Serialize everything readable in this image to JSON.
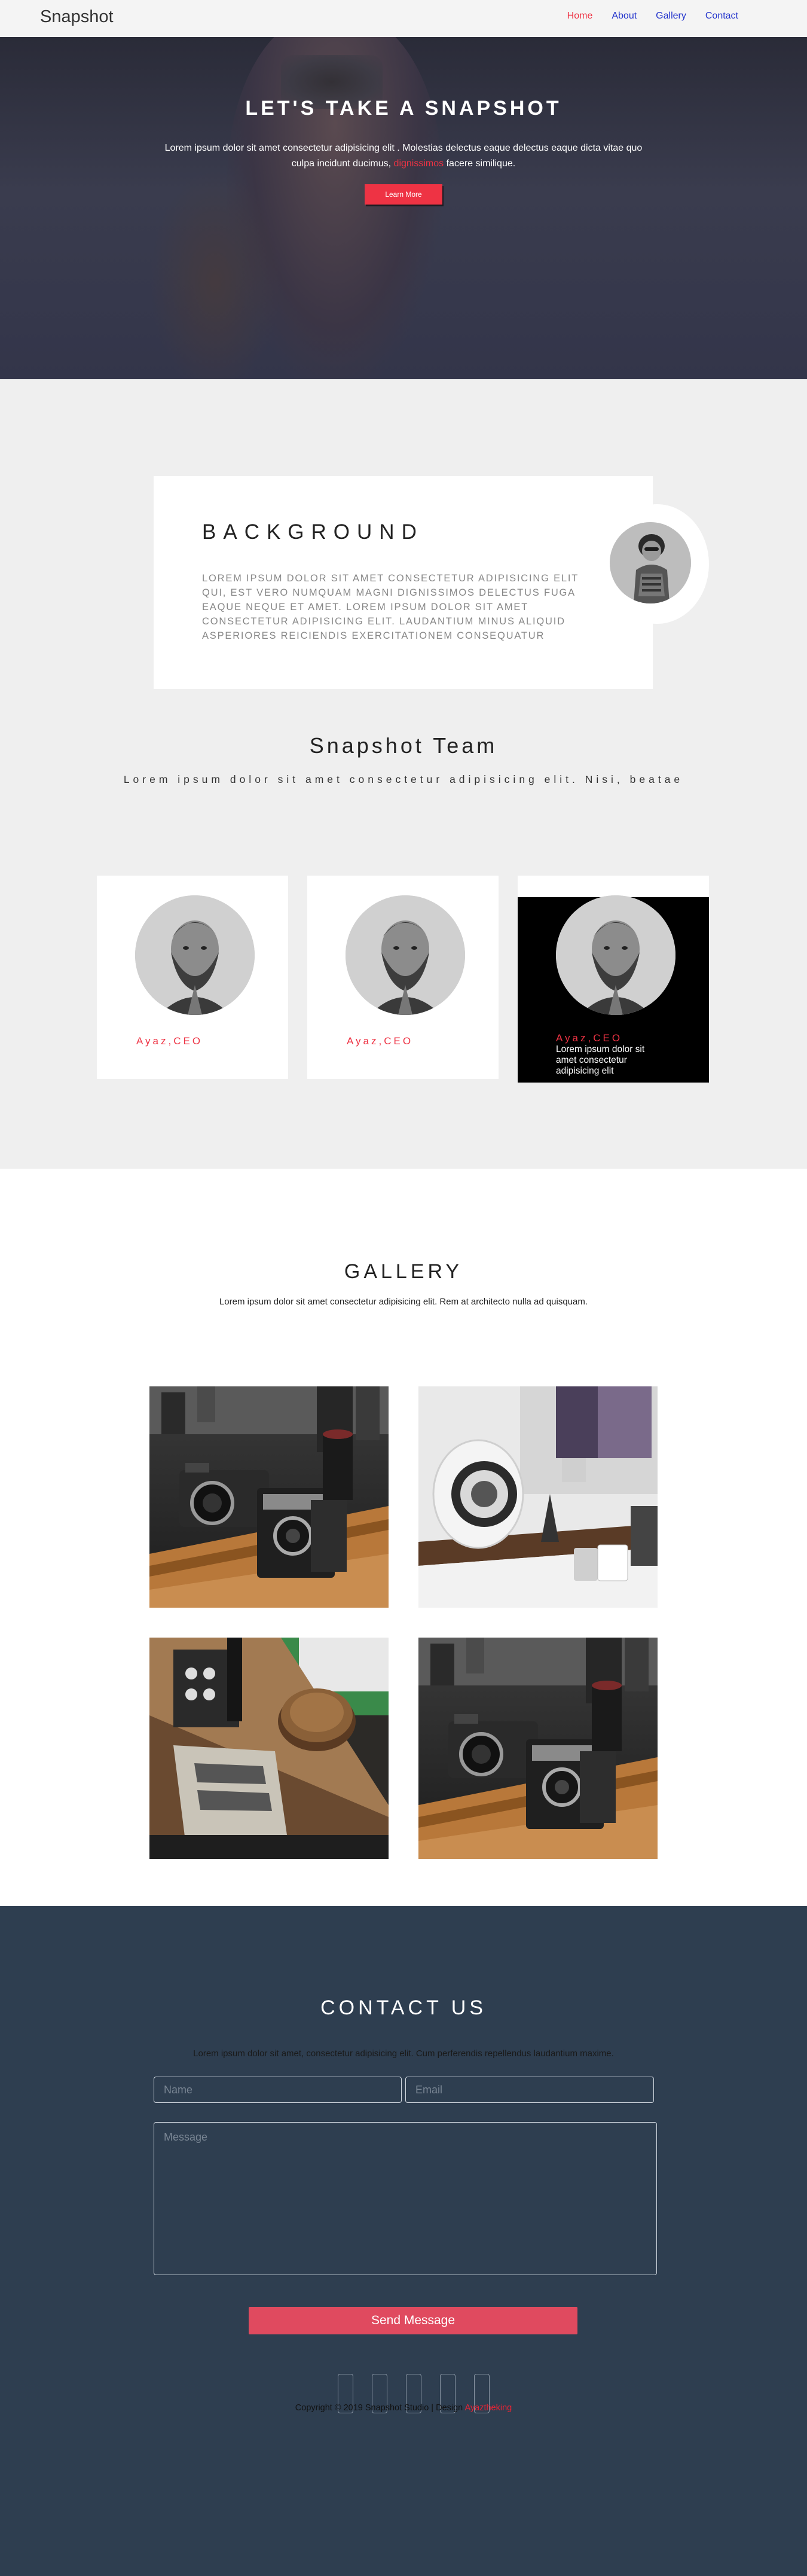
{
  "nav": {
    "brand": "Snapshot",
    "links": [
      {
        "label": "Home",
        "active": true
      },
      {
        "label": "About"
      },
      {
        "label": "Gallery"
      },
      {
        "label": "Contact"
      }
    ]
  },
  "hero": {
    "title": "LET'S TAKE A SNAPSHOT",
    "text_line1": "Lorem ipsum dolor sit amet consectetur adipisicing elit . Molestias delectus eaque delectus eaque dicta vitae quo",
    "text_line2_a": "culpa incidunt ducimus,",
    "text_line2_highlight": "dignissimos",
    "text_line2_b": "facere similique.",
    "button": "Learn More"
  },
  "background": {
    "title": "BACKGROUND",
    "text": "Lorem ipsum dolor sit amet consectetur adipisicing elit qui, est vero numquam magni dignissimos delectus fuga eaque neque et amet. Lorem ipsum dolor sit amet consectetur adipisicing elit. Laudantium minus aliquid asperiores reiciendis exercitationem consequatur"
  },
  "team": {
    "title": "Snapshot Team",
    "subtitle": "Lorem ipsum dolor sit amet consectetur adipisicing elit. Nisi, beatae",
    "members": [
      {
        "name": "Ayaz,CEO"
      },
      {
        "name": "Ayaz,CEO"
      },
      {
        "name": "Ayaz,CEO",
        "description": "Lorem ipsum dolor sit amet consectetur adipisicing elit"
      }
    ]
  },
  "gallery": {
    "title": "GALLERY",
    "subtitle": "Lorem ipsum dolor sit amet consectetur adipisicing elit. Rem at architecto nulla ad quisquam."
  },
  "contact": {
    "title": "CONTACT US",
    "subtitle": "Lorem ipsum dolor sit amet, consectetur adipisicing elit. Cum perferendis repellendus laudantium maxime.",
    "name_placeholder": "Name",
    "email_placeholder": "Email",
    "message_placeholder": "Message",
    "send_button": "Send Message"
  },
  "footer": {
    "copyright": "Copyright © 2019 Snapshot Studio | Design",
    "designer": "Ayaztheking"
  },
  "colors": {
    "accent": "#ee3344",
    "contact_bg": "#2e3e50",
    "section_grey": "#efefef"
  }
}
